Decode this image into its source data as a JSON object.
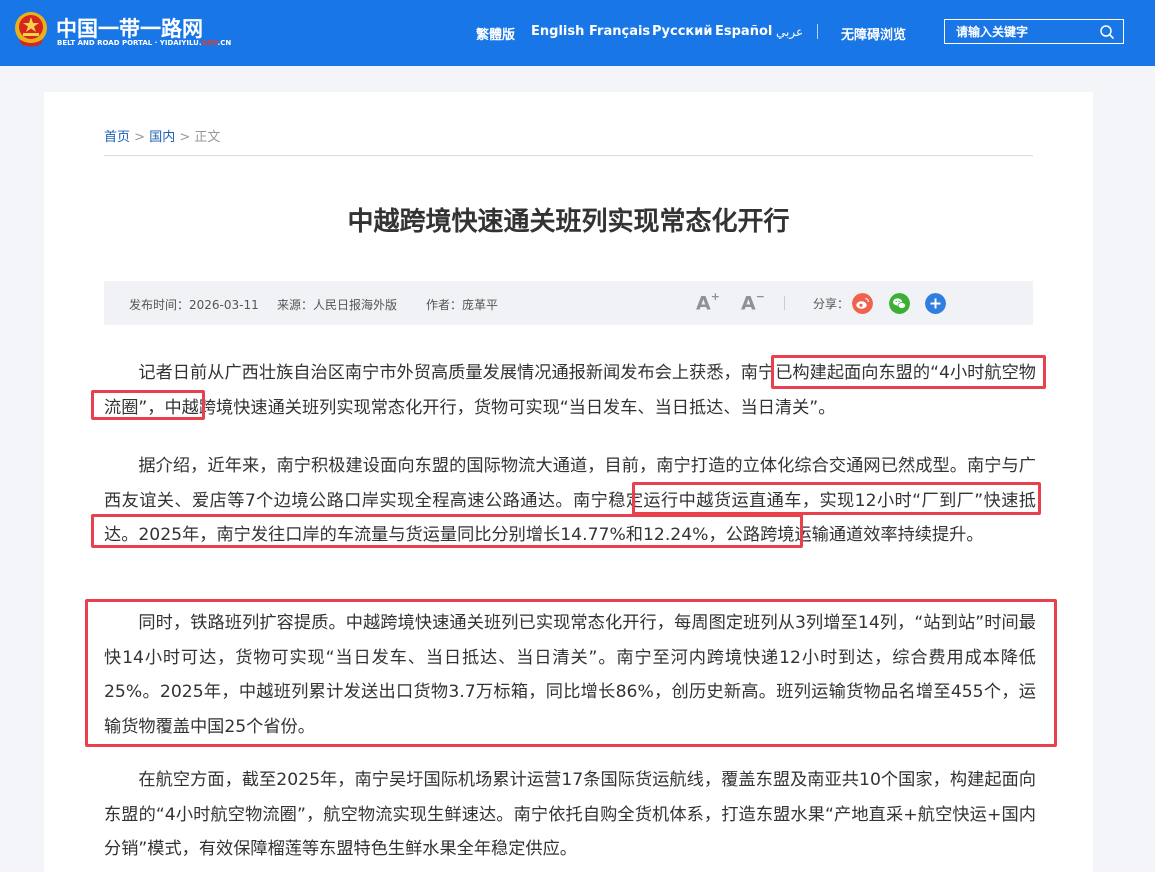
{
  "header": {
    "site_title": "中国一带一路网",
    "site_subtitle_prefix": "BELT AND ROAD PORTAL · YIDAIYILU.",
    "site_subtitle_gov": "GOV",
    "site_subtitle_suffix": ".CN",
    "languages": [
      "繁體版",
      "English",
      "Français",
      "Русский",
      "Español",
      "عربي"
    ],
    "accessibility": "无障碍浏览",
    "search_placeholder": "请输入关键字",
    "brand_color": "#1976e6"
  },
  "breadcrumb": {
    "home": "首页",
    "sep1": ">",
    "section": "国内",
    "sep2": ">",
    "current": "正文"
  },
  "article": {
    "title": "中越跨境快速通关班列实现常态化开行",
    "publish_time": "发布时间：2026-03-11",
    "source": "来源：人民日报海外版",
    "author": "作者：庞革平",
    "font_larger": "A",
    "font_larger_sup": "+",
    "font_smaller": "A",
    "font_smaller_sup": "−",
    "share_label": "分享：",
    "share_icons": [
      "weibo-icon",
      "wechat-icon",
      "more-share-icon"
    ],
    "paragraphs": [
      "记者日前从广西壮族自治区南宁市外贸高质量发展情况通报新闻发布会上获悉，南宁已构建起面向东盟的“4小时航空物流圈”，中越跨境快速通关班列实现常态化开行，货物可实现“当日发车、当日抵达、当日清关”。",
      "据介绍，近年来，南宁积极建设面向东盟的国际物流大通道，目前，南宁打造的立体化综合交通网已然成型。南宁与广西友谊关、爱店等7个边境公路口岸实现全程高速公路通达。南宁稳定运行中越货运直通车，实现12小时“厂到厂”快速抵达。2025年，南宁发往口岸的车流量与货运量同比分别增长14.77%和12.24%，公路跨境运输通道效率持续提升。",
      "同时，铁路班列扩容提质。中越跨境快速通关班列已实现常态化开行，每周图定班列从3列增至14列，“站到站”时间最快14小时可达，货物可实现“当日发车、当日抵达、当日清关”。南宁至河内跨境快递12小时到达，综合费用成本降低25%。2025年，中越班列累计发送出口货物3.7万标箱，同比增长86%，创历史新高。班列运输货物品名增至455个，运输货物覆盖中国25个省份。",
      "在航空方面，截至2025年，南宁吴圩国际机场累计运营17条国际货运航线，覆盖东盟及南亚共10个国家，构建起面向东盟的“4小时航空物流圈”，航空物流实现生鲜速达。南宁依托自购全货机体系，打造东盟水果“产地直采+航空快运+国内分销”模式，有效保障榴莲等东盟特色生鲜水果全年稳定供应。"
    ],
    "highlight_color": "#e8414d"
  }
}
